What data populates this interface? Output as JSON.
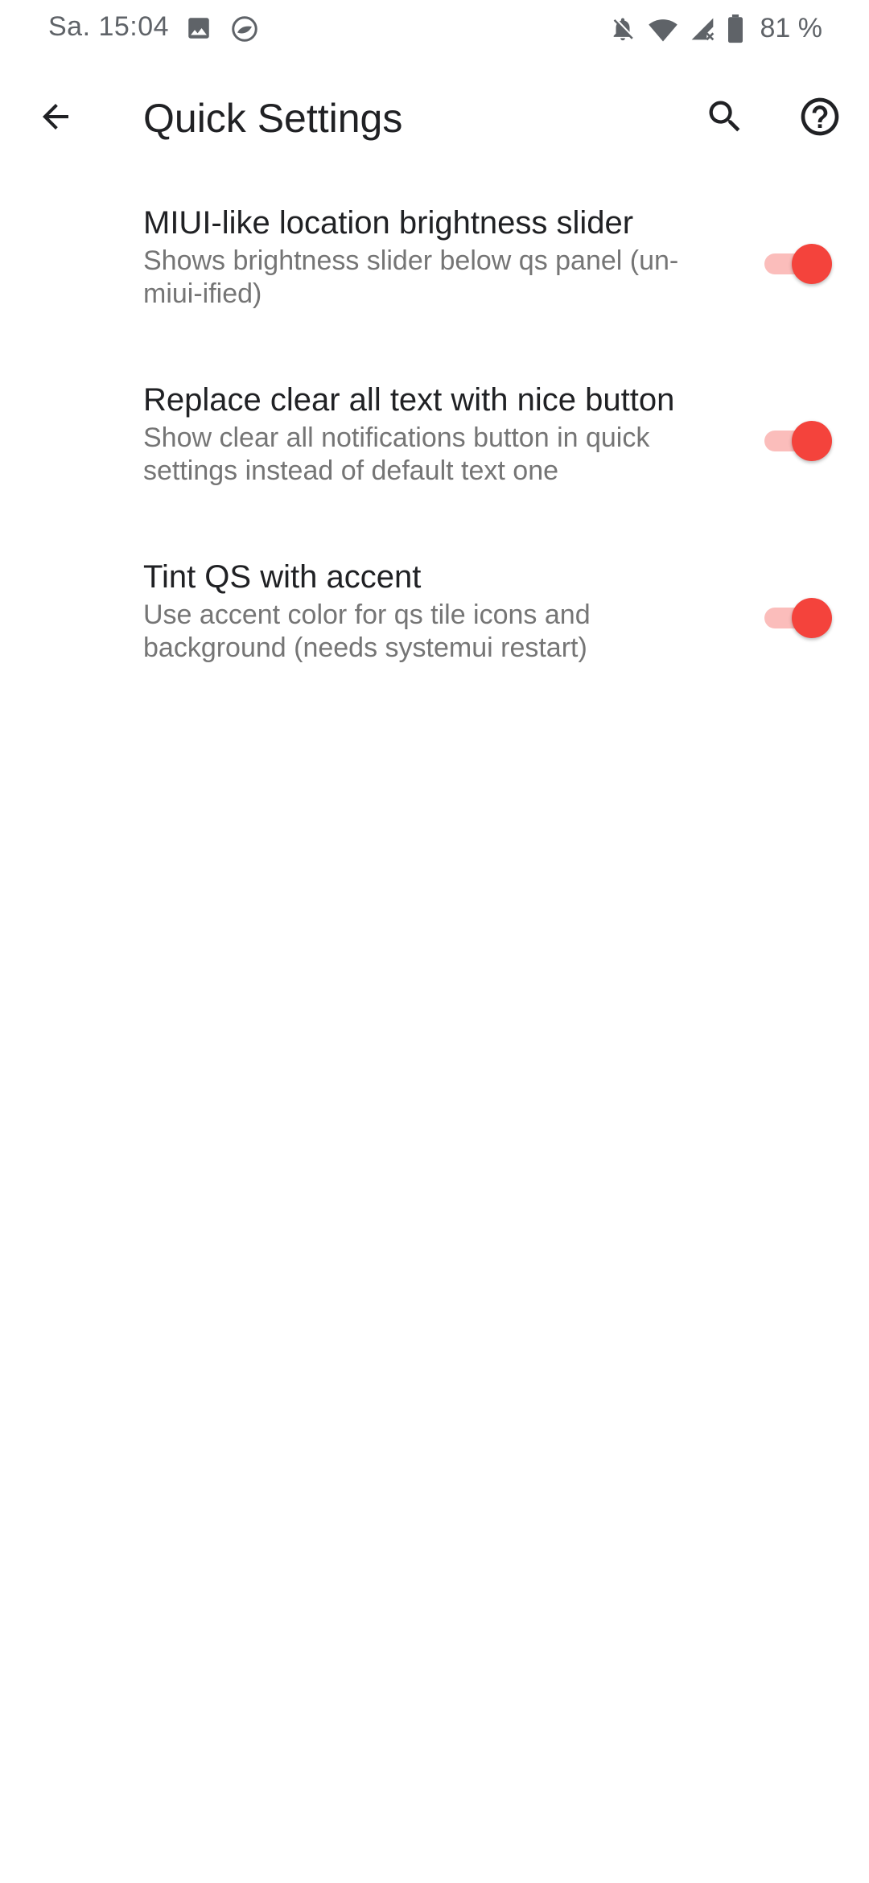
{
  "status_bar": {
    "time": "Sa. 15:04",
    "battery_percent": "81 %",
    "left_icons": [
      "image-icon",
      "app-notification-icon"
    ],
    "right_icons": [
      "notifications-off-icon",
      "wifi-icon",
      "signal-icon",
      "battery-icon"
    ]
  },
  "app_bar": {
    "title": "Quick Settings",
    "back_icon": "arrow-back-icon",
    "search_icon": "search-icon",
    "help_icon": "help-icon"
  },
  "settings": [
    {
      "title": "MIUI-like location brightness slider",
      "summary": "Shows brightness slider below qs panel (un-miui-ified)",
      "enabled": true
    },
    {
      "title": "Replace clear all text with nice button",
      "summary": "Show clear all notifications button in quick settings instead of default text one",
      "enabled": true
    },
    {
      "title": "Tint QS with accent",
      "summary": "Use accent color for qs tile icons and background (needs systemui restart)",
      "enabled": true
    }
  ],
  "colors": {
    "accent": "#f4433c",
    "text_primary": "#202124",
    "text_secondary": "#757575",
    "status_text": "#5f6368",
    "background": "#ffffff"
  }
}
